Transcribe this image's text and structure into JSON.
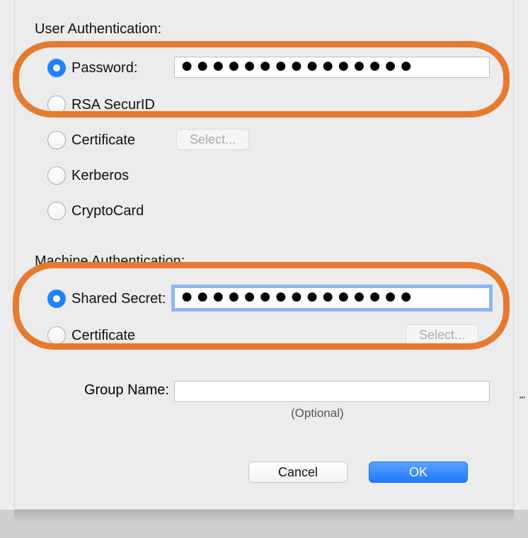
{
  "user_auth": {
    "heading": "User Authentication:",
    "options": {
      "password": {
        "label": "Password:",
        "selected": true,
        "value": "●●●●●●●●●●●●●●●"
      },
      "rsa_securid": {
        "label": "RSA SecurID",
        "selected": false
      },
      "certificate": {
        "label": "Certificate",
        "selected": false,
        "select_btn": "Select..."
      },
      "kerberos": {
        "label": "Kerberos",
        "selected": false
      },
      "cryptocard": {
        "label": "CryptoCard",
        "selected": false
      }
    }
  },
  "machine_auth": {
    "heading": "Machine Authentication:",
    "options": {
      "shared_secret": {
        "label": "Shared Secret:",
        "selected": true,
        "value": "●●●●●●●●●●●●●●●"
      },
      "certificate": {
        "label": "Certificate",
        "selected": false,
        "select_btn": "Select..."
      }
    }
  },
  "group_name": {
    "label": "Group Name:",
    "value": "",
    "optional": "(Optional)"
  },
  "buttons": {
    "cancel": "Cancel",
    "ok": "OK"
  },
  "annotations": {
    "color": "#e67a2f"
  }
}
